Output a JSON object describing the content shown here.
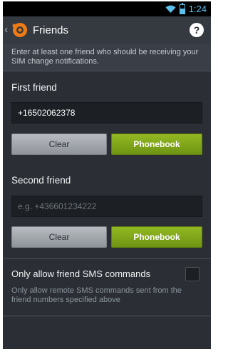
{
  "status_bar": {
    "time": "1:24"
  },
  "action_bar": {
    "title": "Friends",
    "help_label": "?"
  },
  "intro": {
    "text": "Enter at least one friend who should be receiving your SIM change notifications."
  },
  "first_friend": {
    "label": "First friend",
    "value": "+16502062378",
    "clear_label": "Clear",
    "phonebook_label": "Phonebook"
  },
  "second_friend": {
    "label": "Second friend",
    "placeholder": "e.g. +436601234222",
    "clear_label": "Clear",
    "phonebook_label": "Phonebook"
  },
  "sms_option": {
    "label": "Only allow friend SMS commands",
    "description": "Only allow remote SMS commands sent from the friend numbers specified above",
    "checked": false
  },
  "colors": {
    "accent": "#5bc0eb",
    "phonebook_green": "#7fa51a",
    "background": "#2b2f35"
  },
  "icons": {
    "back": "chevron-left-icon",
    "app": "avast-logo-icon",
    "help": "help-icon",
    "wifi": "wifi-icon",
    "battery": "battery-icon"
  }
}
